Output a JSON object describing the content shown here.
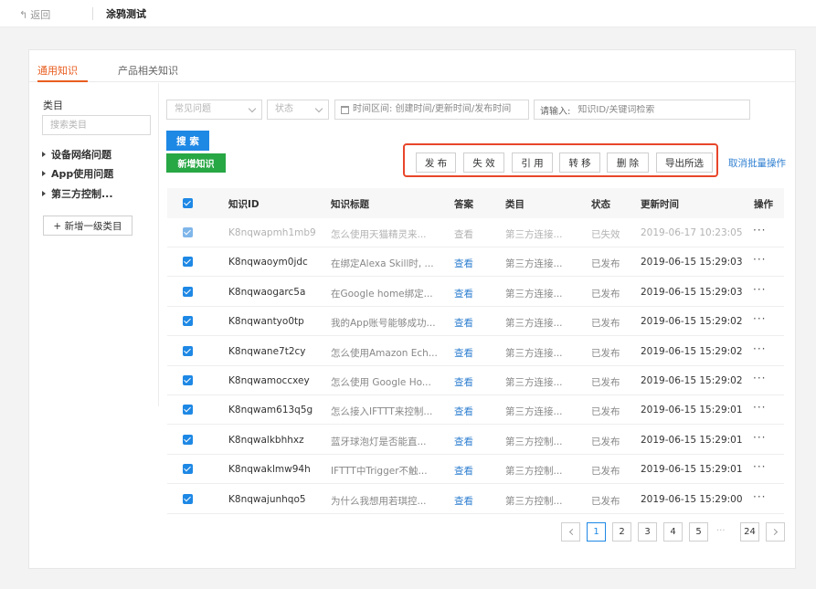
{
  "topbar": {
    "back_label": "返回",
    "title": "涂鸦测试"
  },
  "tabs": [
    {
      "label": "通用知识",
      "active": true
    },
    {
      "label": "产品相关知识",
      "active": false
    }
  ],
  "sidebar": {
    "title": "类目",
    "search_placeholder": "搜索类目",
    "items": [
      {
        "label": "设备网络问题"
      },
      {
        "label": "App使用问题"
      },
      {
        "label": "第三方控制..."
      }
    ],
    "add_button": "+ 新增一级类目"
  },
  "filters": {
    "question_type_placeholder": "常见问题",
    "status_placeholder": "状态",
    "date_placeholder": "时间区间: 创建时间/更新时间/发布时间",
    "keyword_prefix": "请输入:",
    "keyword_placeholder": "知识ID/关键词检索"
  },
  "actions": {
    "search": "搜 索",
    "new_knowledge": "新增知识",
    "batch": [
      "发 布",
      "失 效",
      "引 用",
      "转 移",
      "删 除",
      "导出所选"
    ],
    "cancel_batch": "取消批量操作"
  },
  "table": {
    "columns": [
      "知识ID",
      "知识标题",
      "答案",
      "类目",
      "状态",
      "更新时间",
      "操作"
    ],
    "rows": [
      {
        "id": "K8nqwapmh1mb9",
        "title": "怎么使用天猫精灵来...",
        "answer": "查看",
        "category": "第三方连接...",
        "status": "已失效",
        "updated": "2019-06-17 10:23:05",
        "op": "···",
        "dim": true
      },
      {
        "id": "K8nqwaoym0jdc",
        "title": "在绑定Alexa Skill时, ...",
        "answer": "查看",
        "category": "第三方连接...",
        "status": "已发布",
        "updated": "2019-06-15 15:29:03",
        "op": "···",
        "dim": false
      },
      {
        "id": "K8nqwaogarc5a",
        "title": "在Google home绑定...",
        "answer": "查看",
        "category": "第三方连接...",
        "status": "已发布",
        "updated": "2019-06-15 15:29:03",
        "op": "···",
        "dim": false
      },
      {
        "id": "K8nqwantyo0tp",
        "title": "我的App账号能够成功...",
        "answer": "查看",
        "category": "第三方连接...",
        "status": "已发布",
        "updated": "2019-06-15 15:29:02",
        "op": "···",
        "dim": false
      },
      {
        "id": "K8nqwane7t2cy",
        "title": "怎么使用Amazon Ech...",
        "answer": "查看",
        "category": "第三方连接...",
        "status": "已发布",
        "updated": "2019-06-15 15:29:02",
        "op": "···",
        "dim": false
      },
      {
        "id": "K8nqwamoccxey",
        "title": "怎么使用 Google Ho...",
        "answer": "查看",
        "category": "第三方连接...",
        "status": "已发布",
        "updated": "2019-06-15 15:29:02",
        "op": "···",
        "dim": false
      },
      {
        "id": "K8nqwam613q5g",
        "title": "怎么接入IFTTT来控制...",
        "answer": "查看",
        "category": "第三方连接...",
        "status": "已发布",
        "updated": "2019-06-15 15:29:01",
        "op": "···",
        "dim": false
      },
      {
        "id": "K8nqwalkbhhxz",
        "title": "蓝牙球泡灯是否能直...",
        "answer": "查看",
        "category": "第三方控制...",
        "status": "已发布",
        "updated": "2019-06-15 15:29:01",
        "op": "···",
        "dim": false
      },
      {
        "id": "K8nqwaklmw94h",
        "title": "IFTTT中Trigger不触...",
        "answer": "查看",
        "category": "第三方控制...",
        "status": "已发布",
        "updated": "2019-06-15 15:29:01",
        "op": "···",
        "dim": false
      },
      {
        "id": "K8nqwajunhqo5",
        "title": "为什么我想用若琪控...",
        "answer": "查看",
        "category": "第三方控制...",
        "status": "已发布",
        "updated": "2019-06-15 15:29:00",
        "op": "···",
        "dim": false
      }
    ]
  },
  "pagination": {
    "pages": [
      "1",
      "2",
      "3",
      "4",
      "5"
    ],
    "ellipsis": "···",
    "last": "24",
    "current": "1"
  },
  "colors": {
    "accent": "#1e88e5",
    "brand_tab": "#e85d1f",
    "green": "#28a745",
    "highlight_border": "#e8462a",
    "link": "#2f7fd0"
  }
}
